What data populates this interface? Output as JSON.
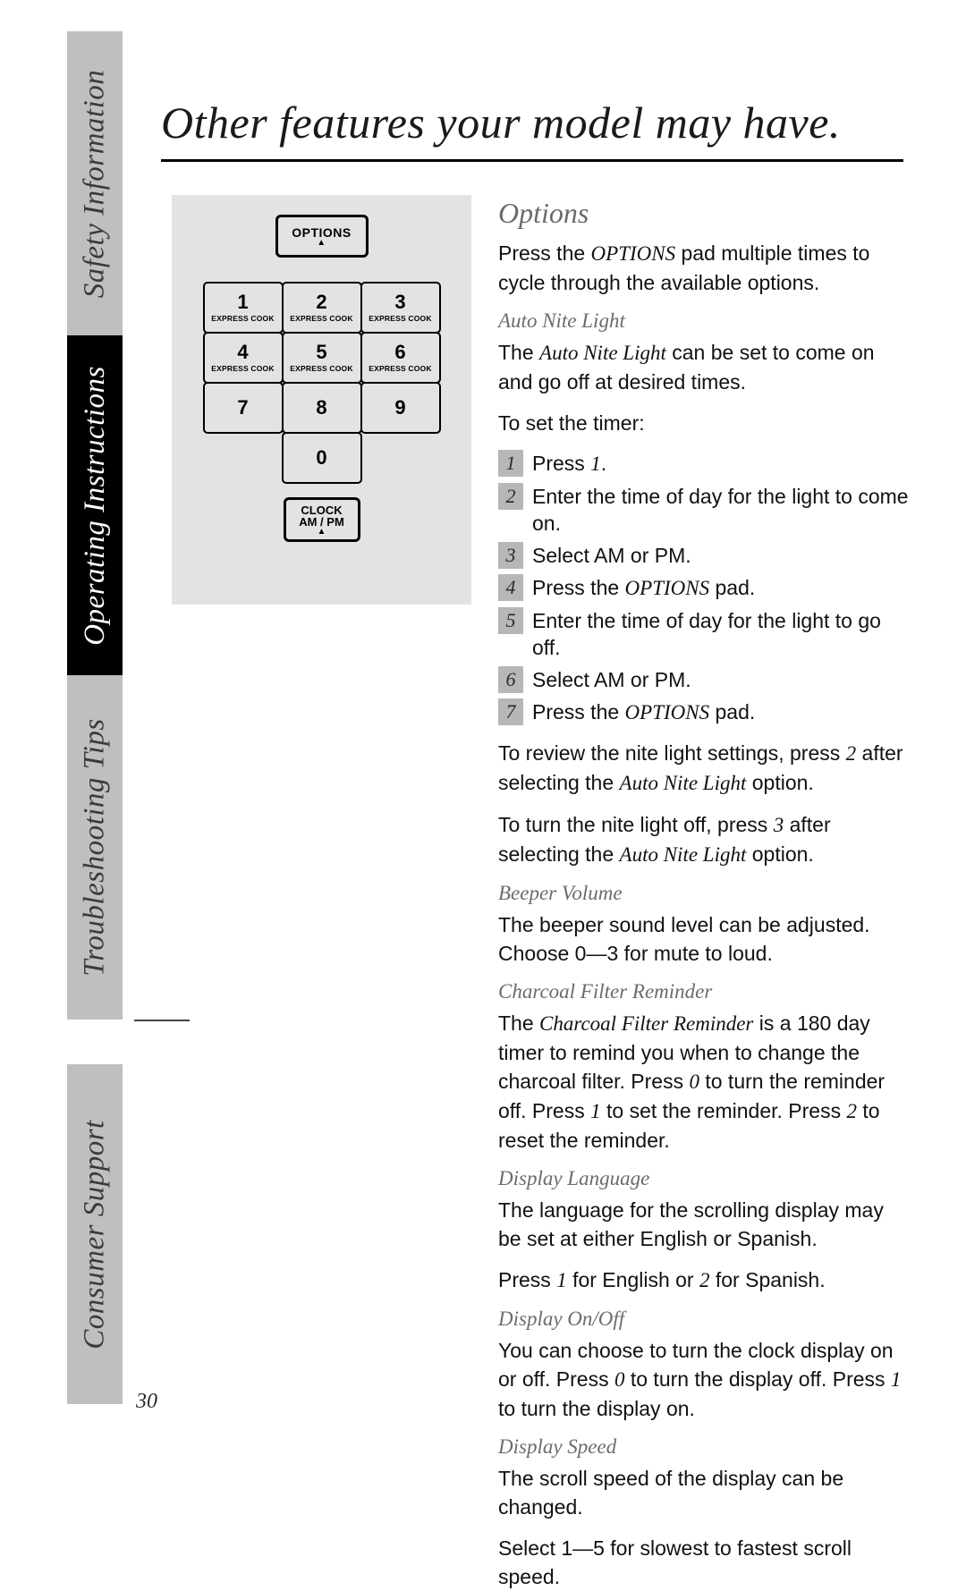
{
  "page_number": "30",
  "title": "Other features your model may have.",
  "tabs": {
    "safety": "Safety Information",
    "operating": "Operating Instructions",
    "troubleshooting": "Troubleshooting Tips",
    "consumer": "Consumer Support"
  },
  "keypad": {
    "options_label": "OPTIONS",
    "clock_line1": "CLOCK",
    "clock_line2": "AM / PM",
    "express": "EXPRESS COOK",
    "keys": [
      "1",
      "2",
      "3",
      "4",
      "5",
      "6",
      "7",
      "8",
      "9",
      "0"
    ]
  },
  "options": {
    "heading": "Options",
    "intro_a": "Press the ",
    "intro_b": "OPTIONS",
    "intro_c": " pad multiple times to cycle through the available options.",
    "auto_nite": {
      "heading": "Auto Nite Light",
      "desc_a": "The ",
      "desc_b": "Auto Nite Light",
      "desc_c": " can be set to come on and go off at desired times.",
      "to_set": "To set the timer:",
      "steps": [
        {
          "n": "1",
          "a": "Press ",
          "b": "1",
          "c": "."
        },
        {
          "n": "2",
          "a": "Enter the time of day for the light to come on.",
          "b": "",
          "c": ""
        },
        {
          "n": "3",
          "a": "Select AM or PM.",
          "b": "",
          "c": ""
        },
        {
          "n": "4",
          "a": "Press the ",
          "b": "OPTIONS",
          "c": " pad."
        },
        {
          "n": "5",
          "a": "Enter the time of day for the light to go off.",
          "b": "",
          "c": ""
        },
        {
          "n": "6",
          "a": "Select AM or PM.",
          "b": "",
          "c": ""
        },
        {
          "n": "7",
          "a": "Press the ",
          "b": "OPTIONS",
          "c": " pad."
        }
      ],
      "review_a": "To review the nite light settings, press ",
      "review_b": "2",
      "review_c": " after selecting the ",
      "review_d": "Auto Nite Light",
      "review_e": " option.",
      "off_a": "To turn the nite light off, press ",
      "off_b": "3",
      "off_c": " after selecting the ",
      "off_d": "Auto Nite Light",
      "off_e": " option."
    },
    "beeper": {
      "heading": "Beeper Volume",
      "body": "The beeper sound level can be adjusted. Choose 0—3 for mute to loud."
    },
    "charcoal": {
      "heading": "Charcoal Filter Reminder",
      "a": "The ",
      "b": "Charcoal Filter Reminder",
      "c": " is a 180 day timer to remind you when to change the charcoal filter. Press ",
      "d": "0",
      "e": " to turn the reminder off. Press ",
      "f": "1",
      "g": " to set the reminder. Press ",
      "h": "2",
      "i": " to reset the reminder."
    },
    "language": {
      "heading": "Display Language",
      "body": "The language for the scrolling display may be set at either English or Spanish.",
      "p2_a": "Press ",
      "p2_b": "1",
      "p2_c": " for English or ",
      "p2_d": "2",
      "p2_e": " for Spanish."
    },
    "display_onoff": {
      "heading": "Display On/Off",
      "a": "You can choose to turn the clock display on or off. Press ",
      "b": "0",
      "c": " to turn the display off. Press ",
      "d": "1",
      "e": " to turn the display on."
    },
    "display_speed": {
      "heading": "Display Speed",
      "body1": "The scroll speed of the display can be changed.",
      "body2": "Select 1—5 for slowest to fastest scroll speed."
    }
  }
}
